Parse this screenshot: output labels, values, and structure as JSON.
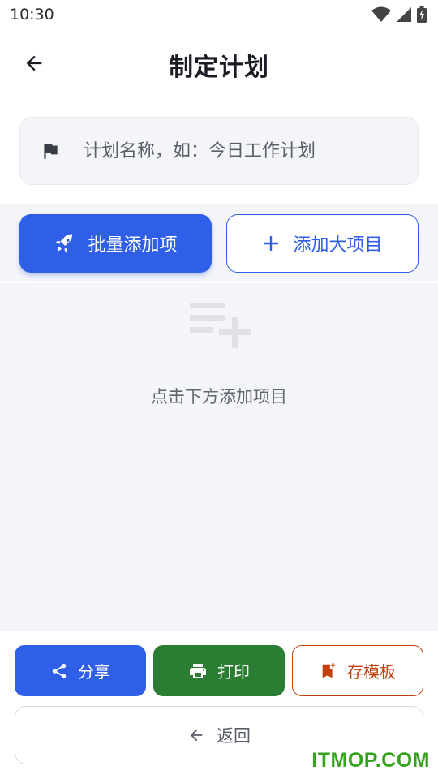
{
  "status_bar": {
    "time": "10:30",
    "icons": [
      "wifi-icon",
      "signal-icon",
      "battery-charging-icon"
    ]
  },
  "app_bar": {
    "title": "制定计划",
    "back_icon": "arrow-left-icon"
  },
  "plan_name_field": {
    "icon": "flag-icon",
    "placeholder": "计划名称，如：今日工作计划",
    "value": ""
  },
  "actions": {
    "batch_add_label": "批量添加项",
    "batch_add_icon": "rocket-icon",
    "add_major_label": "添加大项目",
    "add_major_icon": "plus-icon"
  },
  "empty_state": {
    "icon": "playlist-add-icon",
    "message": "点击下方添加项目"
  },
  "bottom_actions": {
    "share_label": "分享",
    "print_label": "打印",
    "save_template_label": "存模板",
    "return_label": "返回"
  },
  "colors": {
    "primary": "#2f5ee7",
    "print_green": "#2b7d34",
    "template_orange": "#c2410c",
    "panel_bg": "#f4f5f9",
    "watermark_green": "#36a31f"
  },
  "watermark": "ITMOP.COM"
}
